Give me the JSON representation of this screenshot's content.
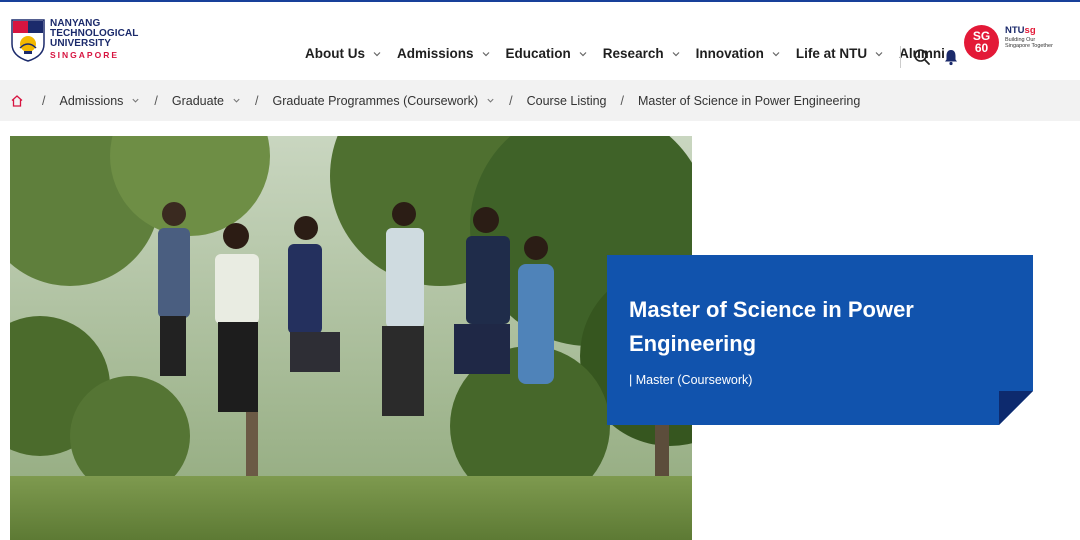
{
  "university": {
    "line1": "NANYANG",
    "line2": "TECHNOLOGICAL",
    "line3": "UNIVERSITY",
    "line4": "SINGAPORE"
  },
  "nav": {
    "items": [
      "About Us",
      "Admissions",
      "Education",
      "Research",
      "Innovation",
      "Life at NTU",
      "Alumni"
    ]
  },
  "header_icons": [
    "search-icon",
    "bell-icon"
  ],
  "sg60": {
    "badge_line1": "SG",
    "badge_line2": "60",
    "brand_prefix": "NTU",
    "brand_suffix": "sg",
    "tagline": "Building Our Singapore Together"
  },
  "breadcrumb": {
    "items": [
      "Admissions",
      "Graduate",
      "Graduate Programmes (Coursework)",
      "Course Listing",
      "Master of Science in Power Engineering"
    ]
  },
  "hero": {
    "title": "Master of Science in Power Engineering",
    "subtitle": "| Master (Coursework)"
  },
  "colors": {
    "primary_blue": "#1153ad",
    "fold_navy": "#0d2a6e",
    "brand_red": "#d71440"
  }
}
